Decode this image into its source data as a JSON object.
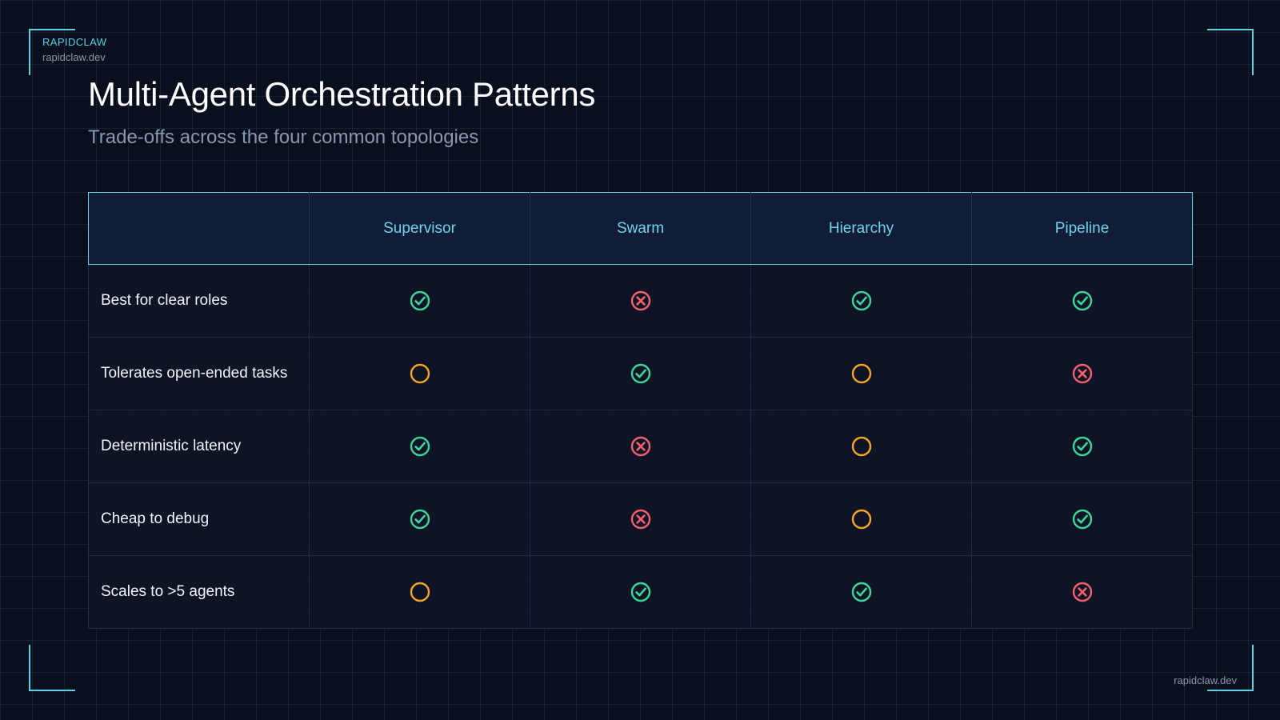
{
  "brand": {
    "name": "RAPIDCLAW",
    "url": "rapidclaw.dev"
  },
  "title": "Multi-Agent Orchestration Patterns",
  "subtitle": "Trade-offs across the four common topologies",
  "colors": {
    "accent": "#5ccfe0",
    "yes": "#3ed598",
    "no": "#f2606b",
    "partial": "#f5a623"
  },
  "table": {
    "columns": [
      "Supervisor",
      "Swarm",
      "Hierarchy",
      "Pipeline"
    ],
    "rows": [
      {
        "label": "Best for clear roles",
        "values": [
          "yes",
          "no",
          "yes",
          "yes"
        ]
      },
      {
        "label": "Tolerates open-ended tasks",
        "values": [
          "partial",
          "yes",
          "partial",
          "no"
        ]
      },
      {
        "label": "Deterministic latency",
        "values": [
          "yes",
          "no",
          "partial",
          "yes"
        ]
      },
      {
        "label": "Cheap to debug",
        "values": [
          "yes",
          "no",
          "partial",
          "yes"
        ]
      },
      {
        "label": "Scales to >5 agents",
        "values": [
          "partial",
          "yes",
          "yes",
          "no"
        ]
      }
    ]
  },
  "footer": {
    "url": "rapidclaw.dev"
  }
}
